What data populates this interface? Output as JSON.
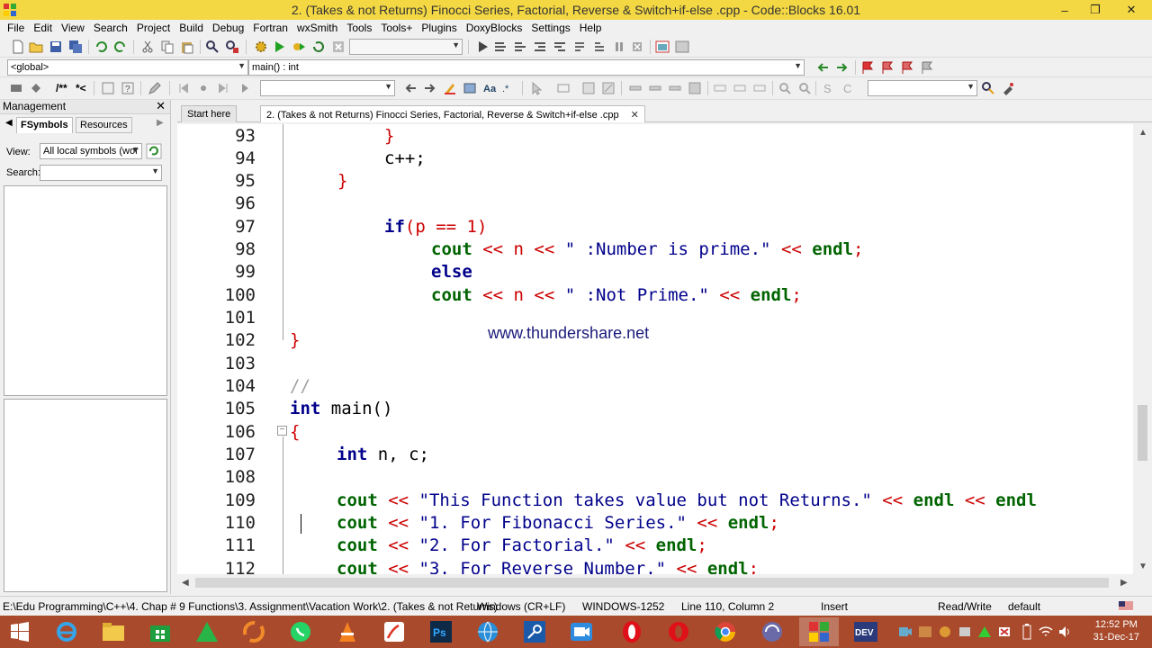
{
  "window": {
    "title": "2. (Takes & not Returns) Finocci Series, Factorial, Reverse & Switch+if-else      .cpp - Code::Blocks 16.01",
    "minimize": "–",
    "maximize": "❐",
    "close": "✕"
  },
  "menu": [
    "File",
    "Edit",
    "View",
    "Search",
    "Project",
    "Build",
    "Debug",
    "Fortran",
    "wxSmith",
    "Tools",
    "Tools+",
    "Plugins",
    "DoxyBlocks",
    "Settings",
    "Help"
  ],
  "toolbar": {
    "scope_combo": "<global>",
    "function_combo": "main() : int",
    "search_combo": "",
    "target_combo": "",
    "doxy_comment1": "/**",
    "doxy_comment2": "*<"
  },
  "management": {
    "title": "Management",
    "close": "✕",
    "tabs": [
      "FSymbols",
      "Resources"
    ],
    "view_label": "View:",
    "view_value": "All local symbols (wor",
    "search_label": "Search:",
    "search_value": ""
  },
  "editor_tabs": [
    {
      "label": "Start here",
      "active": false
    },
    {
      "label": "2. (Takes & not Returns) Finocci Series, Factorial, Reverse & Switch+if-else       .cpp",
      "active": true,
      "close": "✕"
    }
  ],
  "code_lines": [
    {
      "n": "93"
    },
    {
      "n": "94"
    },
    {
      "n": "95"
    },
    {
      "n": "96"
    },
    {
      "n": "97"
    },
    {
      "n": "98"
    },
    {
      "n": "99"
    },
    {
      "n": "100"
    },
    {
      "n": "101"
    },
    {
      "n": "102"
    },
    {
      "n": "103"
    },
    {
      "n": "104"
    },
    {
      "n": "105"
    },
    {
      "n": "106"
    },
    {
      "n": "107"
    },
    {
      "n": "108"
    },
    {
      "n": "109"
    },
    {
      "n": "110"
    },
    {
      "n": "111"
    },
    {
      "n": "112"
    }
  ],
  "code": {
    "l93": "}",
    "l94": "c++;",
    "l95": "}",
    "l97_kw": "if",
    "l97_rest": "(p == 1)",
    "l98_fn": "cout",
    "l98_a": " << n << ",
    "l98_str": "\" :Number is prime.\"",
    "l98_b": " << ",
    "l98_endl": "endl",
    "l98_end": ";",
    "l99": "else",
    "l100_fn": "cout",
    "l100_a": " << n << ",
    "l100_str": "\" :Not Prime.\"",
    "l100_b": " << ",
    "l100_endl": "endl",
    "l100_end": ";",
    "l102": "}",
    "l104": "//",
    "l105_kw": "int",
    "l105_rest": " main()",
    "l106": "{",
    "l107_kw": "int",
    "l107_rest": " n, c;",
    "l109_fn": "cout",
    "l109_a": " << ",
    "l109_str": "\"This Function takes value but not Returns.\"",
    "l109_b": " << ",
    "l109_endl": "endl",
    "l109_c": " << ",
    "l109_endl2": "endl",
    "l110_fn": "cout",
    "l110_a": " << ",
    "l110_str": "\"1. For Fibonacci Series.\"",
    "l110_b": " << ",
    "l110_endl": "endl",
    "l110_end": ";",
    "l111_fn": "cout",
    "l111_a": " << ",
    "l111_str": "\"2. For Factorial.\"",
    "l111_b": " << ",
    "l111_endl": "endl",
    "l111_end": ";",
    "l112_fn": "cout",
    "l112_a": " << ",
    "l112_str": "\"3. For Reverse Number.\"",
    "l112_b": " << ",
    "l112_endl": "endl",
    "l112_end": ";"
  },
  "watermark": "www.thundershare.net",
  "status": {
    "path": "E:\\Edu Programming\\C++\\4. Chap # 9  Functions\\3. Assignment\\Vacation Work\\2. (Takes & not Returns)",
    "eol": "Windows (CR+LF)",
    "encoding": "WINDOWS-1252",
    "position": "Line 110, Column 2",
    "mode": "Insert",
    "access": "Read/Write",
    "lang": "default"
  },
  "taskbar": {
    "time": "12:52 PM",
    "date": "31-Dec-17"
  },
  "colors": {
    "titlebar": "#f4d843",
    "keyword": "#00008b",
    "function": "#006400",
    "operator": "#cc0000",
    "taskbar": "#a94a2c"
  }
}
